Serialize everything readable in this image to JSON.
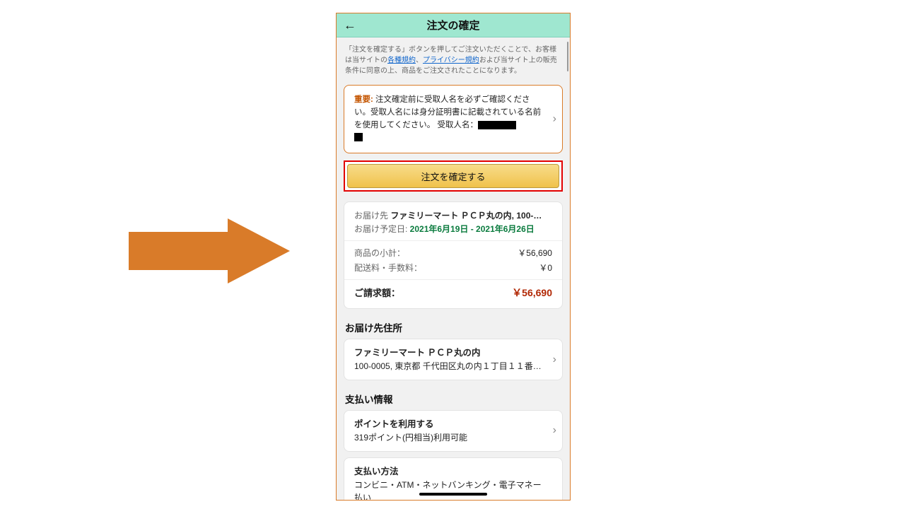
{
  "header": {
    "title": "注文の確定"
  },
  "legal": {
    "pre": "「注文を確定する」ボタンを押してご注文いただくことで、お客様は当サイトの",
    "link_terms": "各種規約",
    "sep": "、",
    "link_privacy": "プライバシー規約",
    "post": "および当サイト上の販売条件に同意の上、商品をご注文されたことになります。"
  },
  "notice": {
    "important_label": "重要:",
    "text_1": " 注文確定前に受取人名を必ずご確認ください。受取人名には身分証明書に記載されている名前を使用してください。 受取人名："
  },
  "confirm": {
    "button_label": "注文を確定する"
  },
  "summary": {
    "deliver_to_label": "お届け先",
    "deliver_to_value": " ファミリーマート ＰＣＰ丸の内, 100-…",
    "deliver_date_label": "お届け予定日: ",
    "deliver_date_value": "2021年6月19日 - 2021年6月26日",
    "subtotal_label": "商品の小計：",
    "subtotal_value": "￥56,690",
    "shipping_label": "配送料・手数料：",
    "shipping_value": "￥0",
    "total_label": "ご請求額：",
    "total_value": "￥56,690"
  },
  "address_section": {
    "title": "お届け先住所",
    "name": "ファミリーマート ＰＣＰ丸の内",
    "line": "100-0005, 東京都 千代田区丸の内１丁目１１番…"
  },
  "payment_section": {
    "title": "支払い情報",
    "points_title": "ポイントを利用する",
    "points_line": "319ポイント(円相当)利用可能",
    "method_title": "支払い方法",
    "method_line": "コンビニ・ATM・ネットバンキング・電子マネー払い"
  }
}
